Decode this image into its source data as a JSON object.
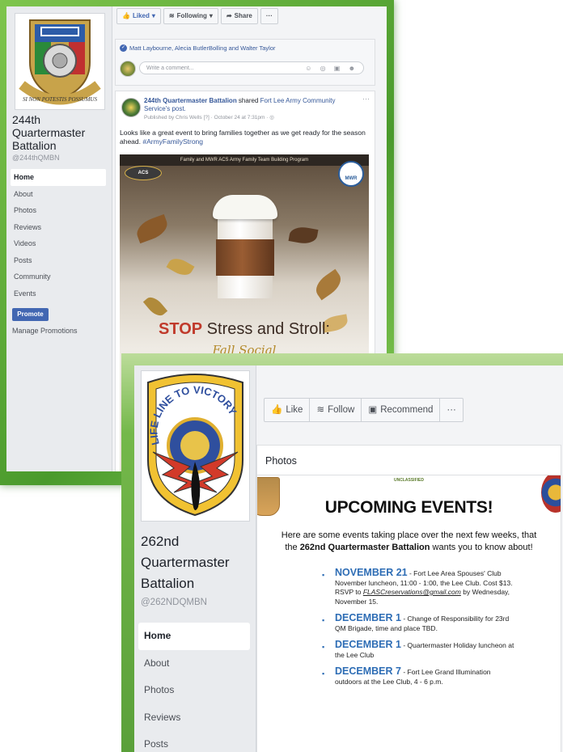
{
  "panel1": {
    "page_name": "244th Quartermaster Battalion",
    "handle": "@244thQMBN",
    "logo_motto": "SI NON POTESTIS POSSUMUS",
    "nav": [
      "Home",
      "About",
      "Photos",
      "Reviews",
      "Videos",
      "Posts",
      "Community",
      "Events"
    ],
    "promote_label": "Promote",
    "manage_label": "Manage Promotions",
    "actions": {
      "liked": "Liked",
      "following": "Following",
      "share": "Share",
      "more": "···"
    },
    "likers": "Matt Laybourne, Alecia ButlerBolling and Walter Taylor",
    "comment_placeholder": "Write a comment...",
    "comment_icons": "☺ ◎ ▣ ☻",
    "post": {
      "author": "244th Quartermaster Battalion",
      "verb": " shared ",
      "source": "Fort Lee Army Community Service",
      "suffix": "'s post.",
      "meta": "Published by Chris Wells [?] · October 24 at 7:31pm · ◎",
      "text": "Looks like a great event to bring families together as we get ready for the season ahead. ",
      "hashtag": "#ArmyFamilyStrong",
      "more": "···"
    },
    "flyer": {
      "top_line": "Family and MWR ACS Army Family Team Building Program",
      "acs": "ACS",
      "mwr": "MWR",
      "stop_word": "STOP",
      "headline_rest": " Stress and Stroll:",
      "script_line": "Fall Social"
    }
  },
  "panel2": {
    "page_name": "262nd Quartermaster Battalion",
    "handle": "@262NDQMBN",
    "logo_motto": "LIFE LINE TO VICTORY",
    "nav": [
      "Home",
      "About",
      "Photos",
      "Reviews",
      "Posts"
    ],
    "actions": {
      "like": "Like",
      "follow": "Follow",
      "recommend": "Recommend",
      "more": "···"
    },
    "section_title": "Photos",
    "sheet": {
      "classification": "UNCLASSIFIED",
      "title": "UPCOMING EVENTS!",
      "intro_before": "Here are some events taking place over the next few weeks, that the ",
      "intro_bold": "262nd Quartermaster Battalion",
      "intro_after": " wants you to know about!",
      "events": [
        {
          "date": "NOVEMBER 21",
          "text": " - Fort Lee Area Spouses' Club November luncheon, 11:00 - 1:00, the Lee Club. Cost $13. RSVP to ",
          "email": "FLASCreservations@gmail.com",
          "tail": " by Wednesday, November 15."
        },
        {
          "date": "DECEMBER 1",
          "text": " - Change of Responsibility for 23rd QM Brigade, time and place TBD.",
          "email": "",
          "tail": ""
        },
        {
          "date": "DECEMBER 1",
          "text": " - Quartermaster Holiday luncheon at the Lee Club",
          "email": "",
          "tail": ""
        },
        {
          "date": "DECEMBER 7",
          "text": " - Fort Lee Grand Illumination outdoors at the Lee Club, 4 - 6 p.m.",
          "email": "",
          "tail": ""
        }
      ]
    }
  },
  "colors": {
    "facebook_blue": "#4267b2",
    "link_blue": "#365899",
    "frame_green": "#5aa03a",
    "event_blue": "#2e6db5"
  }
}
